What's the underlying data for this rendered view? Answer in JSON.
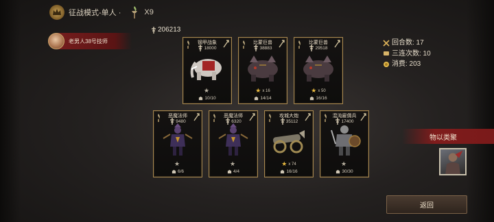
{
  "header": {
    "mode_label": "征战模式-单人 ·",
    "torch_count": "X9"
  },
  "player": {
    "name": "老男人38号技师"
  },
  "power_total": "206213",
  "stats": [
    {
      "icon": "crossed-swords-icon",
      "text": "回合数: 17"
    },
    {
      "icon": "scroll-icon",
      "text": "三连次数: 10"
    },
    {
      "icon": "coin-icon",
      "text": "消费: 203"
    }
  ],
  "cards": [
    {
      "name": "钢甲战象",
      "power": "18000",
      "stars": "",
      "star_count": 1,
      "gold": false,
      "troops": "10/10",
      "art": "elephant"
    },
    {
      "name": "比蒙巨兽",
      "power": "38883",
      "stars": "x 16",
      "star_count": 1,
      "gold": true,
      "troops": "14/14",
      "art": "behemoth"
    },
    {
      "name": "比蒙巨兽",
      "power": "29518",
      "stars": "x 50",
      "star_count": 1,
      "gold": true,
      "troops": "16/16",
      "art": "behemoth"
    },
    {
      "name": "恶魔法师",
      "power": "9480",
      "stars": "",
      "star_count": 1,
      "gold": false,
      "troops": "6/6",
      "art": "demon"
    },
    {
      "name": "恶魔法师",
      "power": "6320",
      "stars": "",
      "star_count": 1,
      "gold": false,
      "troops": "4/4",
      "art": "demon"
    },
    {
      "name": "攻城大炮",
      "power": "35112",
      "stars": "x 74",
      "star_count": 1,
      "gold": true,
      "troops": "16/16",
      "art": "cannon"
    },
    {
      "name": "混沌雇佣兵",
      "power": "17400",
      "stars": "",
      "star_count": 1,
      "gold": false,
      "troops": "30/30",
      "art": "mercenary"
    }
  ],
  "bonus": {
    "label": "物以类聚"
  },
  "back_button": {
    "label": "返回"
  }
}
